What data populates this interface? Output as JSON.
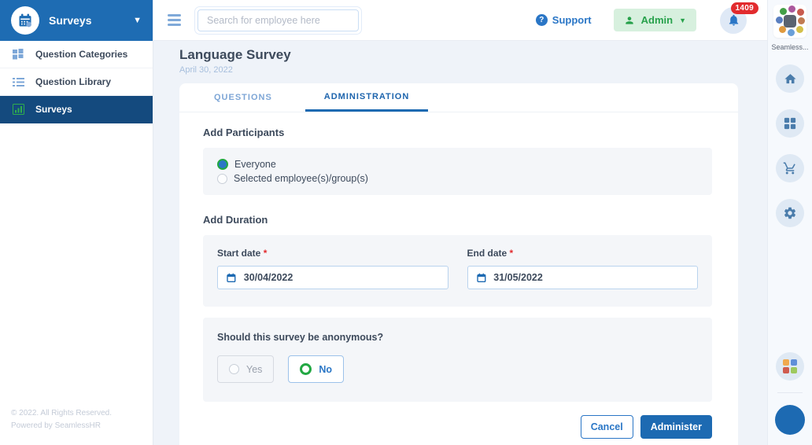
{
  "colors": {
    "header_blue": "#1e6cb3",
    "active_navy": "#144a7e",
    "accent_blue": "#2a76c6",
    "green": "#22a843",
    "badge_red": "#e22b2e",
    "panel_gray": "#f4f6f9"
  },
  "sidebar": {
    "title": "Surveys",
    "items": [
      {
        "label": "Question Categories",
        "icon": "grid-icon",
        "active": false
      },
      {
        "label": "Question Library",
        "icon": "list-icon",
        "active": false
      },
      {
        "label": "Surveys",
        "icon": "bar-chart-icon",
        "active": true
      }
    ],
    "footer_line1": "© 2022. All Rights Reserved.",
    "footer_line2": "Powered by SeamlessHR"
  },
  "topbar": {
    "search_placeholder": "Search for employee here",
    "support_label": "Support",
    "admin_label": "Admin",
    "notification_count": "1409"
  },
  "rail": {
    "app_label": "Seamless...",
    "icons": [
      "home-icon",
      "grid-icon",
      "cart-icon",
      "gear-icon",
      "apps-icon",
      "avatar"
    ]
  },
  "main": {
    "title": "Language Survey",
    "date": "April 30, 2022",
    "tabs": [
      {
        "label": "QUESTIONS",
        "active": false
      },
      {
        "label": "ADMINISTRATION",
        "active": true
      }
    ],
    "participants": {
      "heading": "Add Participants",
      "options": [
        {
          "label": "Everyone",
          "selected": true
        },
        {
          "label": "Selected employee(s)/group(s)",
          "selected": false
        }
      ]
    },
    "duration": {
      "heading": "Add Duration",
      "start_label": "Start date",
      "end_label": "End date",
      "required_marker": "*",
      "start_value": "30/04/2022",
      "end_value": "31/05/2022"
    },
    "anonymous": {
      "question": "Should this survey be anonymous?",
      "options": [
        {
          "label": "Yes",
          "selected": false
        },
        {
          "label": "No",
          "selected": true
        }
      ]
    },
    "actions": {
      "cancel_label": "Cancel",
      "submit_label": "Administer"
    }
  }
}
